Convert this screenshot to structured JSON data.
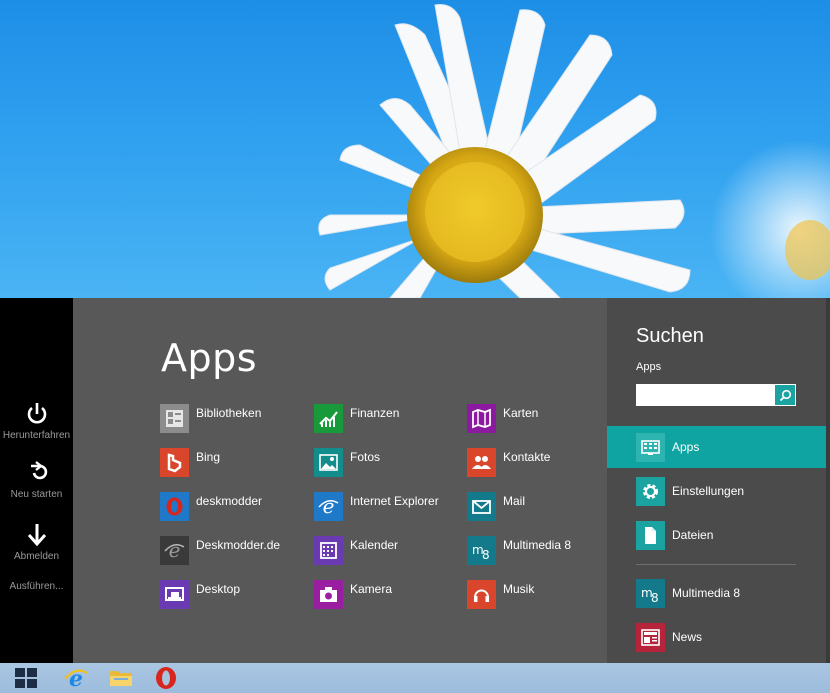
{
  "power": {
    "shutdown_label": "Herunterfahren",
    "restart_label": "Neu starten",
    "signout_label": "Abmelden",
    "run_label": "Ausführen..."
  },
  "apps_panel": {
    "title": "Apps",
    "columns": [
      [
        {
          "label": "Bibliotheken",
          "icon": "libraries-icon",
          "color": "#8c8c8c"
        },
        {
          "label": "Bing",
          "icon": "bing-icon",
          "color": "#d9462b"
        },
        {
          "label": "deskmodder",
          "icon": "opera-icon",
          "color": "#1f79c8"
        },
        {
          "label": "Deskmodder.de",
          "icon": "ie-gray-icon",
          "color": "#3a3a3a"
        },
        {
          "label": "Desktop",
          "icon": "desktop-icon",
          "color": "#6a3ab2"
        }
      ],
      [
        {
          "label": "Finanzen",
          "icon": "finance-icon",
          "color": "#189a3a"
        },
        {
          "label": "Fotos",
          "icon": "photos-icon",
          "color": "#138d8c"
        },
        {
          "label": "Internet Explorer",
          "icon": "ie-icon",
          "color": "#1f79c8"
        },
        {
          "label": "Kalender",
          "icon": "calendar-icon",
          "color": "#6a3ab2"
        },
        {
          "label": "Kamera",
          "icon": "camera-icon",
          "color": "#9a1fa0"
        }
      ],
      [
        {
          "label": "Karten",
          "icon": "maps-icon",
          "color": "#8b1aa0"
        },
        {
          "label": "Kontakte",
          "icon": "people-icon",
          "color": "#d9462b"
        },
        {
          "label": "Mail",
          "icon": "mail-icon",
          "color": "#137a8c"
        },
        {
          "label": "Multimedia 8",
          "icon": "multimedia-icon",
          "color": "#137a8c"
        },
        {
          "label": "Musik",
          "icon": "music-icon",
          "color": "#d9462b"
        }
      ]
    ]
  },
  "search": {
    "title": "Suchen",
    "scope_label": "Apps",
    "query": "",
    "placeholder": "",
    "categories": [
      {
        "label": "Apps",
        "icon": "apps-icon",
        "selected": true
      },
      {
        "label": "Einstellungen",
        "icon": "settings-icon",
        "selected": false
      },
      {
        "label": "Dateien",
        "icon": "files-icon",
        "selected": false
      }
    ],
    "recent": [
      {
        "label": "Multimedia 8",
        "icon": "multimedia-icon",
        "color": "#137a8c"
      },
      {
        "label": "News",
        "icon": "news-icon",
        "color": "#b5243a"
      }
    ]
  },
  "taskbar": {
    "items": [
      "start-button",
      "internet-explorer",
      "file-explorer",
      "opera"
    ]
  },
  "colors": {
    "accent": "#0fa3a1",
    "apps_bg": "#585858",
    "search_bg": "#4b4b4b",
    "power_bg": "#000000"
  }
}
